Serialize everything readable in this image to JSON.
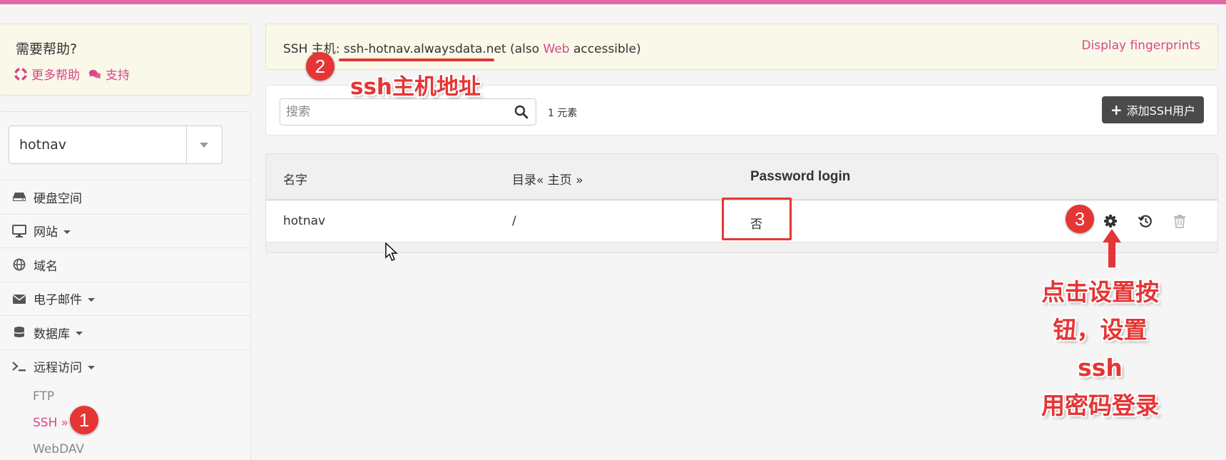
{
  "help": {
    "title": "需要帮助?",
    "more_help": "更多帮助",
    "support": "支持"
  },
  "account": {
    "selected": "hotnav"
  },
  "nav": {
    "items": [
      {
        "label": "硬盘空间",
        "icon": "hdd-icon"
      },
      {
        "label": "网站",
        "icon": "monitor-icon",
        "dropdown": true
      },
      {
        "label": "域名",
        "icon": "globe-icon"
      },
      {
        "label": "电子邮件",
        "icon": "envelope-icon",
        "dropdown": true
      },
      {
        "label": "数据库",
        "icon": "database-icon",
        "dropdown": true
      },
      {
        "label": "远程访问",
        "icon": "terminal-icon",
        "dropdown": true
      }
    ],
    "sub_items": [
      "FTP",
      "SSH »",
      "WebDAV"
    ],
    "active_sub": "SSH »"
  },
  "banner": {
    "prefix": "SSH 主机: ",
    "host": "ssh-hotnav.alwaysdata.net",
    "also": " (also ",
    "web": "Web",
    "suffix": " accessible)",
    "fingerprints": "Display fingerprints"
  },
  "toolbar": {
    "search_placeholder": "搜索",
    "count": "1 元素",
    "add_button": "添加SSH用户"
  },
  "table": {
    "headers": [
      "名字",
      "目录« 主页 »",
      "Password login"
    ],
    "rows": [
      {
        "name": "hotnav",
        "directory": "/",
        "password_login": "否"
      }
    ]
  },
  "annotations": {
    "n1": "1",
    "n2": "2",
    "n3": "3",
    "label2": "ssh主机地址",
    "label3_line1": "点击设置按",
    "label3_line2": "钮，设置ssh",
    "label3_line3": "用密码登录",
    "color": "#e53535"
  },
  "colors": {
    "accent": "#d6478a",
    "topbar": "#e06aa5",
    "button_dark": "#4a4a4a"
  }
}
